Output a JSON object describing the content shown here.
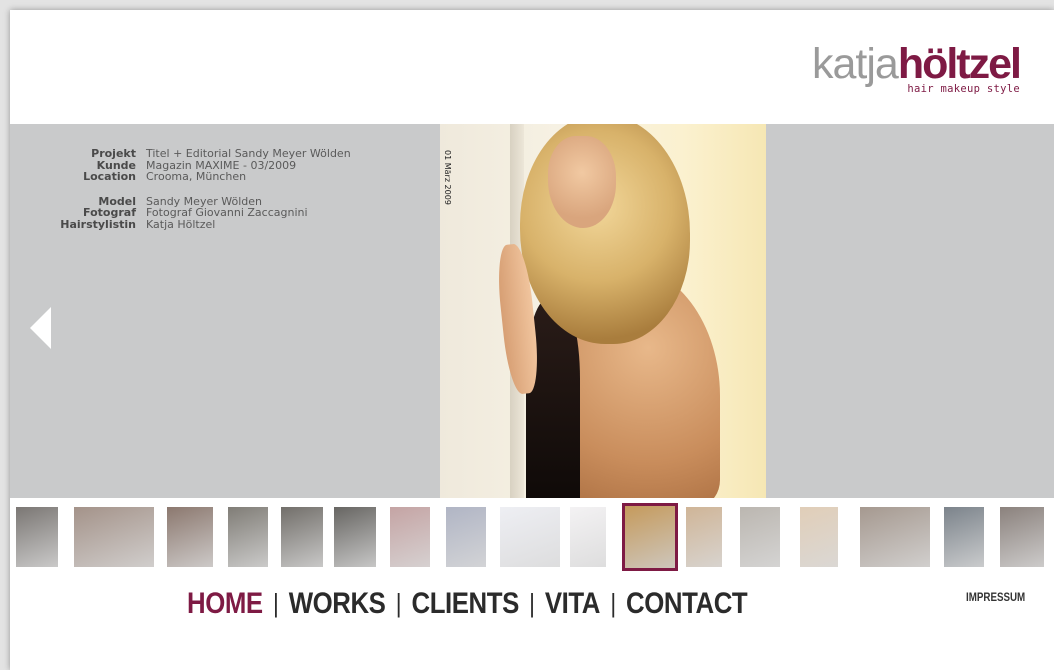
{
  "brand": {
    "name_light": "katja",
    "name_bold": "höltzel",
    "tagline": "hair makeup style",
    "accent_color": "#7e1a44"
  },
  "project_info": [
    {
      "label": "Projekt",
      "value": "Titel + Editorial Sandy Meyer Wölden"
    },
    {
      "label": "Kunde",
      "value": "Magazin MAXIME - 03/2009"
    },
    {
      "label": "Location",
      "value": "Crooma, München"
    }
  ],
  "credits_info": [
    {
      "label": "Model",
      "value": "Sandy Meyer Wölden"
    },
    {
      "label": "Fotograf",
      "value": "Fotograf Giovanni Zaccagnini"
    },
    {
      "label": "Hairstylistin",
      "value": "Katja Höltzel"
    }
  ],
  "photo": {
    "side_text": "01 März 2009"
  },
  "thumbnails": [
    {
      "name": "thumb-1",
      "tone": "#55504c"
    },
    {
      "name": "thumb-2",
      "tone": "#8a7468"
    },
    {
      "name": "thumb-3",
      "tone": "#6b5246"
    },
    {
      "name": "thumb-4",
      "tone": "#5c5850"
    },
    {
      "name": "thumb-5",
      "tone": "#4a4640"
    },
    {
      "name": "thumb-6",
      "tone": "#3c3a36"
    },
    {
      "name": "thumb-7",
      "tone": "#b48a8a"
    },
    {
      "name": "thumb-8",
      "tone": "#9aa0b4"
    },
    {
      "name": "thumb-9",
      "tone": "#e9eaf0"
    },
    {
      "name": "thumb-10",
      "tone": "#f0eef0"
    },
    {
      "name": "thumb-11",
      "tone": "#c59a5c",
      "active": true
    },
    {
      "name": "thumb-12",
      "tone": "#c2a07a"
    },
    {
      "name": "thumb-13",
      "tone": "#a8a29a"
    },
    {
      "name": "thumb-14",
      "tone": "#d8c0a4"
    },
    {
      "name": "thumb-15",
      "tone": "#8c7c70"
    },
    {
      "name": "thumb-16",
      "tone": "#56606a"
    },
    {
      "name": "thumb-17",
      "tone": "#6a5e58"
    }
  ],
  "nav": {
    "items": [
      {
        "label": "HOME",
        "current": true
      },
      {
        "label": "WORKS"
      },
      {
        "label": "CLIENTS"
      },
      {
        "label": "VITA"
      },
      {
        "label": "CONTACT"
      }
    ],
    "separator": "|",
    "impressum": "IMPRESSUM"
  }
}
